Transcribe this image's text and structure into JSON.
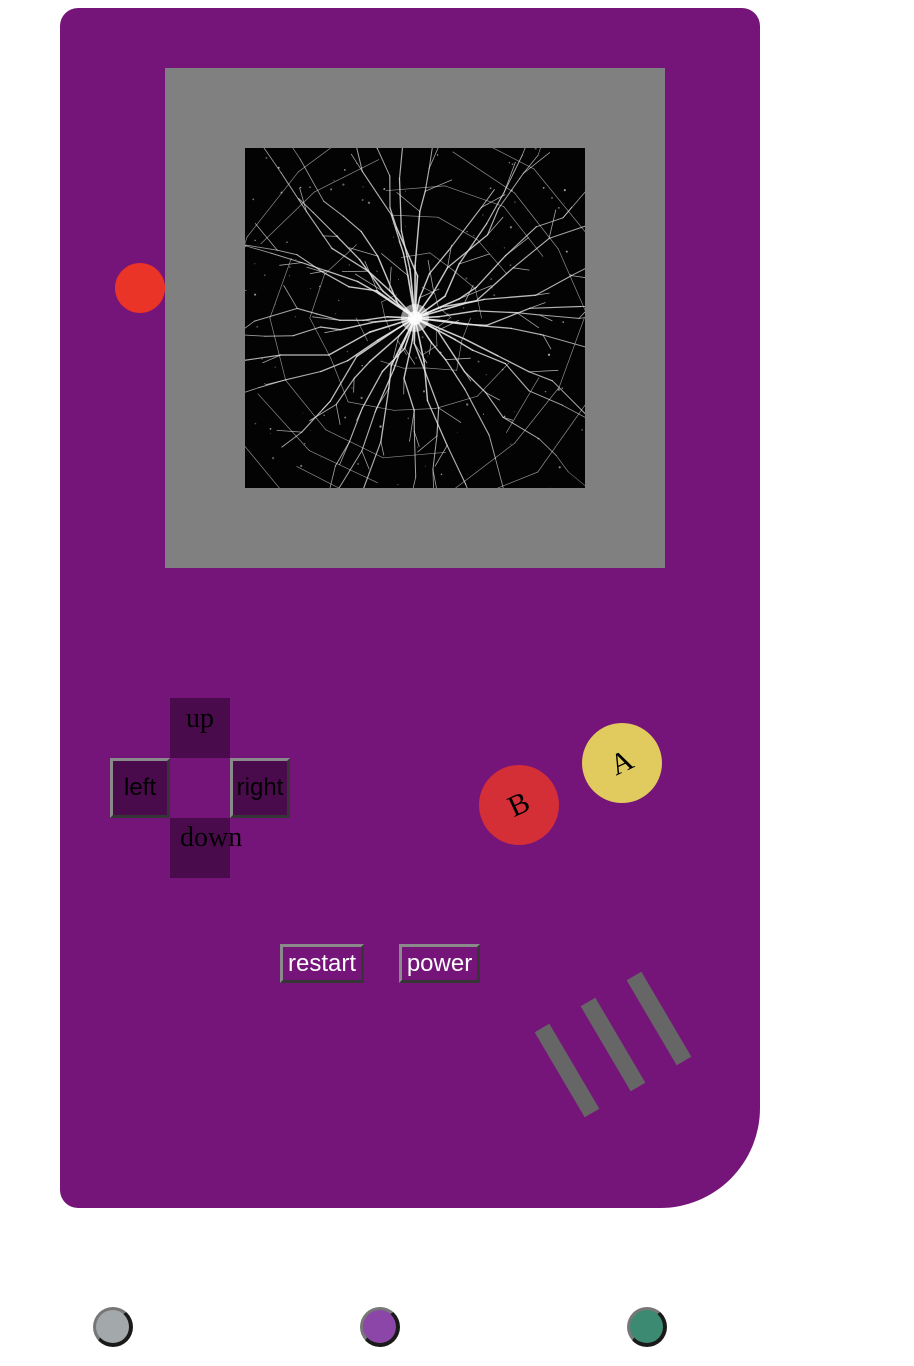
{
  "console": {
    "color": "#761579",
    "screen_bezel_color": "#808080",
    "screen_content": "cracked-glass-image",
    "power_led_color": "#ea3427"
  },
  "dpad": {
    "up_label": "up",
    "down_label": "down",
    "left_label": "left",
    "right_label": "right",
    "color": "#4a0b4c"
  },
  "buttons": {
    "a_label": "A",
    "a_color": "#e1ca5e",
    "b_label": "B",
    "b_color": "#d42f36"
  },
  "system": {
    "restart_label": "restart",
    "power_label": "power"
  },
  "speaker": {
    "slot_count": 3,
    "color": "#666666"
  },
  "theme_swatches": [
    {
      "name": "gray",
      "color": "#a3a9aa"
    },
    {
      "name": "purple",
      "color": "#8c46a8"
    },
    {
      "name": "green",
      "color": "#3d8a72"
    }
  ]
}
